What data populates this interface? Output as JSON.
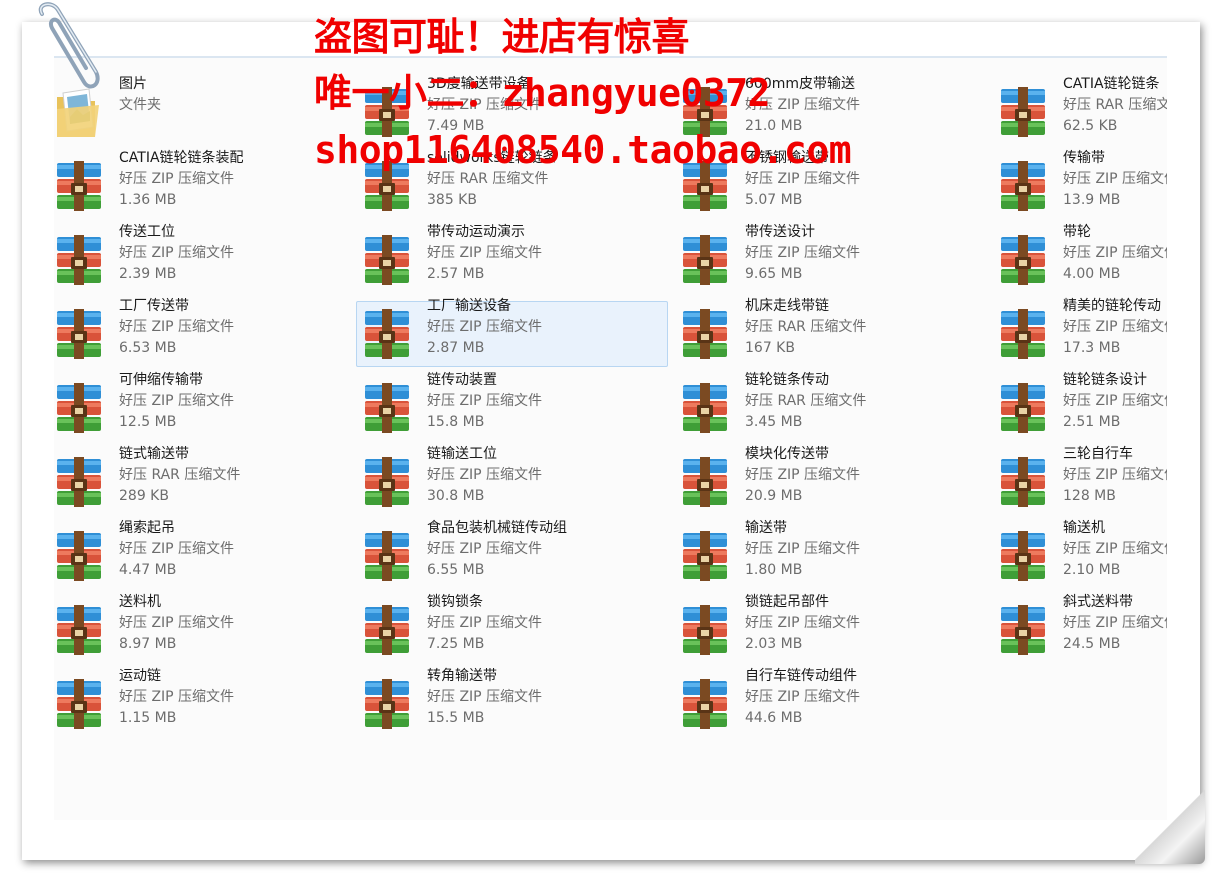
{
  "watermark": {
    "line1": "盗图可耻！进店有惊喜",
    "line2": "唯一小二：zhangyue0372",
    "line3": "shop116408540.taobao.com"
  },
  "folder": {
    "name": "图片",
    "type": "文件夹"
  },
  "colors": {
    "watermark": "#f00000",
    "selection_bg": "#e9f2fc",
    "selection_border": "#b8d6f2"
  },
  "icons": {
    "archive": "winrar-archive-icon",
    "folder": "picture-folder-icon",
    "clip": "paperclip-icon"
  },
  "columns": [
    [
      {
        "name": "CATIA链轮链条装配",
        "type": "好压 ZIP 压缩文件",
        "size": "1.36 MB"
      },
      {
        "name": "传送工位",
        "type": "好压 ZIP 压缩文件",
        "size": "2.39 MB"
      },
      {
        "name": "工厂传送带",
        "type": "好压 ZIP 压缩文件",
        "size": "6.53 MB"
      },
      {
        "name": "可伸缩传输带",
        "type": "好压 ZIP 压缩文件",
        "size": "12.5 MB"
      },
      {
        "name": "链式输送带",
        "type": "好压 RAR 压缩文件",
        "size": "289 KB"
      },
      {
        "name": "绳索起吊",
        "type": "好压 ZIP 压缩文件",
        "size": "4.47 MB"
      },
      {
        "name": "送料机",
        "type": "好压 ZIP 压缩文件",
        "size": "8.97 MB"
      },
      {
        "name": "运动链",
        "type": "好压 ZIP 压缩文件",
        "size": "1.15 MB"
      }
    ],
    [
      {
        "name": "3D度输送带设备",
        "type": "好压 ZIP 压缩文件",
        "size": "7.49 MB"
      },
      {
        "name": "solidworks链轮链条",
        "type": "好压 RAR 压缩文件",
        "size": "385 KB"
      },
      {
        "name": "带传动运动演示",
        "type": "好压 ZIP 压缩文件",
        "size": "2.57 MB"
      },
      {
        "name": "工厂输送设备",
        "type": "好压 ZIP 压缩文件",
        "size": "2.87 MB",
        "selected": true
      },
      {
        "name": "链传动装置",
        "type": "好压 ZIP 压缩文件",
        "size": "15.8 MB"
      },
      {
        "name": "链输送工位",
        "type": "好压 ZIP 压缩文件",
        "size": "30.8 MB"
      },
      {
        "name": "食品包装机械链传动组",
        "type": "好压 ZIP 压缩文件",
        "size": "6.55 MB"
      },
      {
        "name": "锁钩锁条",
        "type": "好压 ZIP 压缩文件",
        "size": "7.25 MB"
      },
      {
        "name": "转角输送带",
        "type": "好压 ZIP 压缩文件",
        "size": "15.5 MB"
      }
    ],
    [
      {
        "name": "600mm皮带输送",
        "type": "好压 ZIP 压缩文件",
        "size": "21.0 MB"
      },
      {
        "name": "不锈钢输送带",
        "type": "好压 ZIP 压缩文件",
        "size": "5.07 MB"
      },
      {
        "name": "带传送设计",
        "type": "好压 ZIP 压缩文件",
        "size": "9.65 MB"
      },
      {
        "name": "机床走线带链",
        "type": "好压 RAR 压缩文件",
        "size": "167 KB"
      },
      {
        "name": "链轮链条传动",
        "type": "好压 RAR 压缩文件",
        "size": "3.45 MB"
      },
      {
        "name": "模块化传送带",
        "type": "好压 ZIP 压缩文件",
        "size": "20.9 MB"
      },
      {
        "name": "输送带",
        "type": "好压 ZIP 压缩文件",
        "size": "1.80 MB"
      },
      {
        "name": "锁链起吊部件",
        "type": "好压 ZIP 压缩文件",
        "size": "2.03 MB"
      },
      {
        "name": "自行车链传动组件",
        "type": "好压 ZIP 压缩文件",
        "size": "44.6 MB"
      }
    ],
    [
      {
        "name": "CATIA链轮链条",
        "type": "好压 RAR 压缩文件",
        "size": "62.5 KB"
      },
      {
        "name": "传输带",
        "type": "好压 ZIP 压缩文件",
        "size": "13.9 MB"
      },
      {
        "name": "带轮",
        "type": "好压 ZIP 压缩文件",
        "size": "4.00 MB"
      },
      {
        "name": "精美的链轮传动",
        "type": "好压 ZIP 压缩文件",
        "size": "17.3 MB"
      },
      {
        "name": "链轮链条设计",
        "type": "好压 ZIP 压缩文件",
        "size": "2.51 MB"
      },
      {
        "name": "三轮自行车",
        "type": "好压 ZIP 压缩文件",
        "size": "128 MB"
      },
      {
        "name": "输送机",
        "type": "好压 ZIP 压缩文件",
        "size": "2.10 MB"
      },
      {
        "name": "斜式送料带",
        "type": "好压 ZIP 压缩文件",
        "size": "24.5 MB"
      }
    ]
  ]
}
